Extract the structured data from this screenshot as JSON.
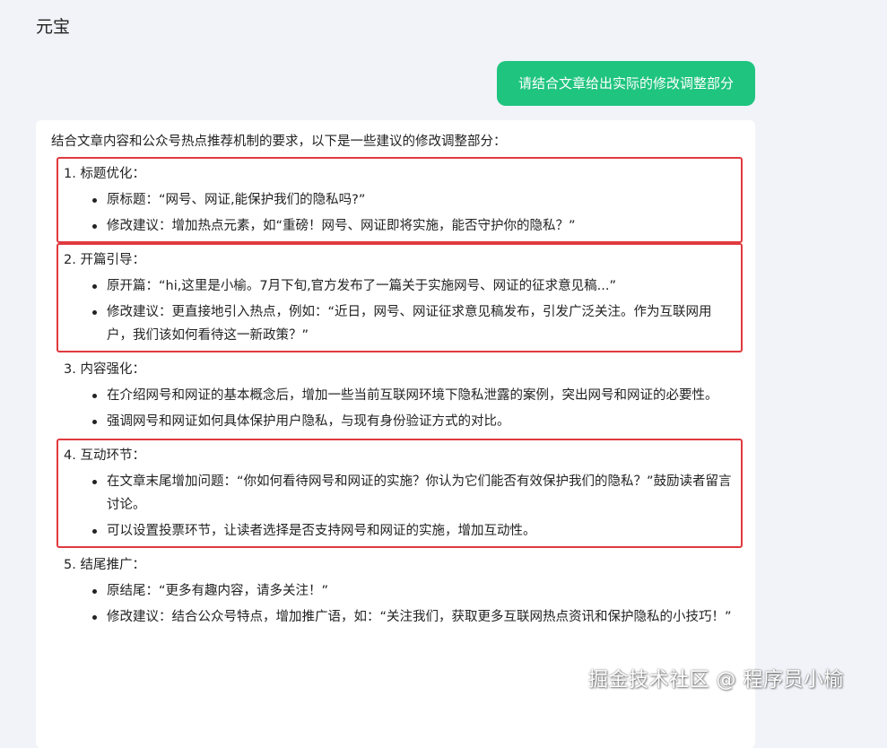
{
  "app": {
    "title": "元宝"
  },
  "chat": {
    "user_message": "请结合文章给出实际的修改调整部分",
    "answer_intro": "结合文章内容和公众号热点推荐机制的要求，以下是一些建议的修改调整部分：",
    "sections": [
      {
        "title": "1. 标题优化：",
        "highlighted": true,
        "bullets": [
          "原标题：“网号、网证,能保护我们的隐私吗?”",
          "修改建议：增加热点元素，如“重磅！网号、网证即将实施，能否守护你的隐私？”"
        ]
      },
      {
        "title": "2. 开篇引导：",
        "highlighted": true,
        "bullets": [
          "原开篇：“hi,这里是小榆。7月下旬,官方发布了一篇关于实施网号、网证的征求意见稿...”",
          "修改建议：更直接地引入热点，例如：“近日，网号、网证征求意见稿发布，引发广泛关注。作为互联网用户，我们该如何看待这一新政策？”"
        ]
      },
      {
        "title": "3. 内容强化：",
        "highlighted": false,
        "bullets": [
          "在介绍网号和网证的基本概念后，增加一些当前互联网环境下隐私泄露的案例，突出网号和网证的必要性。",
          "强调网号和网证如何具体保护用户隐私，与现有身份验证方式的对比。"
        ]
      },
      {
        "title": "4. 互动环节：",
        "highlighted": true,
        "bullets": [
          "在文章末尾增加问题：“你如何看待网号和网证的实施？你认为它们能否有效保护我们的隐私？”鼓励读者留言讨论。",
          "可以设置投票环节，让读者选择是否支持网号和网证的实施，增加互动性。"
        ]
      },
      {
        "title": "5. 结尾推广：",
        "highlighted": false,
        "bullets": [
          "原结尾：“更多有趣内容，请多关注！”",
          "修改建议：结合公众号特点，增加推广语，如：“关注我们，获取更多互联网热点资讯和保护隐私的小技巧！”"
        ]
      }
    ]
  },
  "watermark": "掘金技术社区 @ 程序员小榆",
  "colors": {
    "accent_green": "#1fc47f",
    "highlight_red": "#e03a3f",
    "page_bg": "#f1f3f8"
  }
}
